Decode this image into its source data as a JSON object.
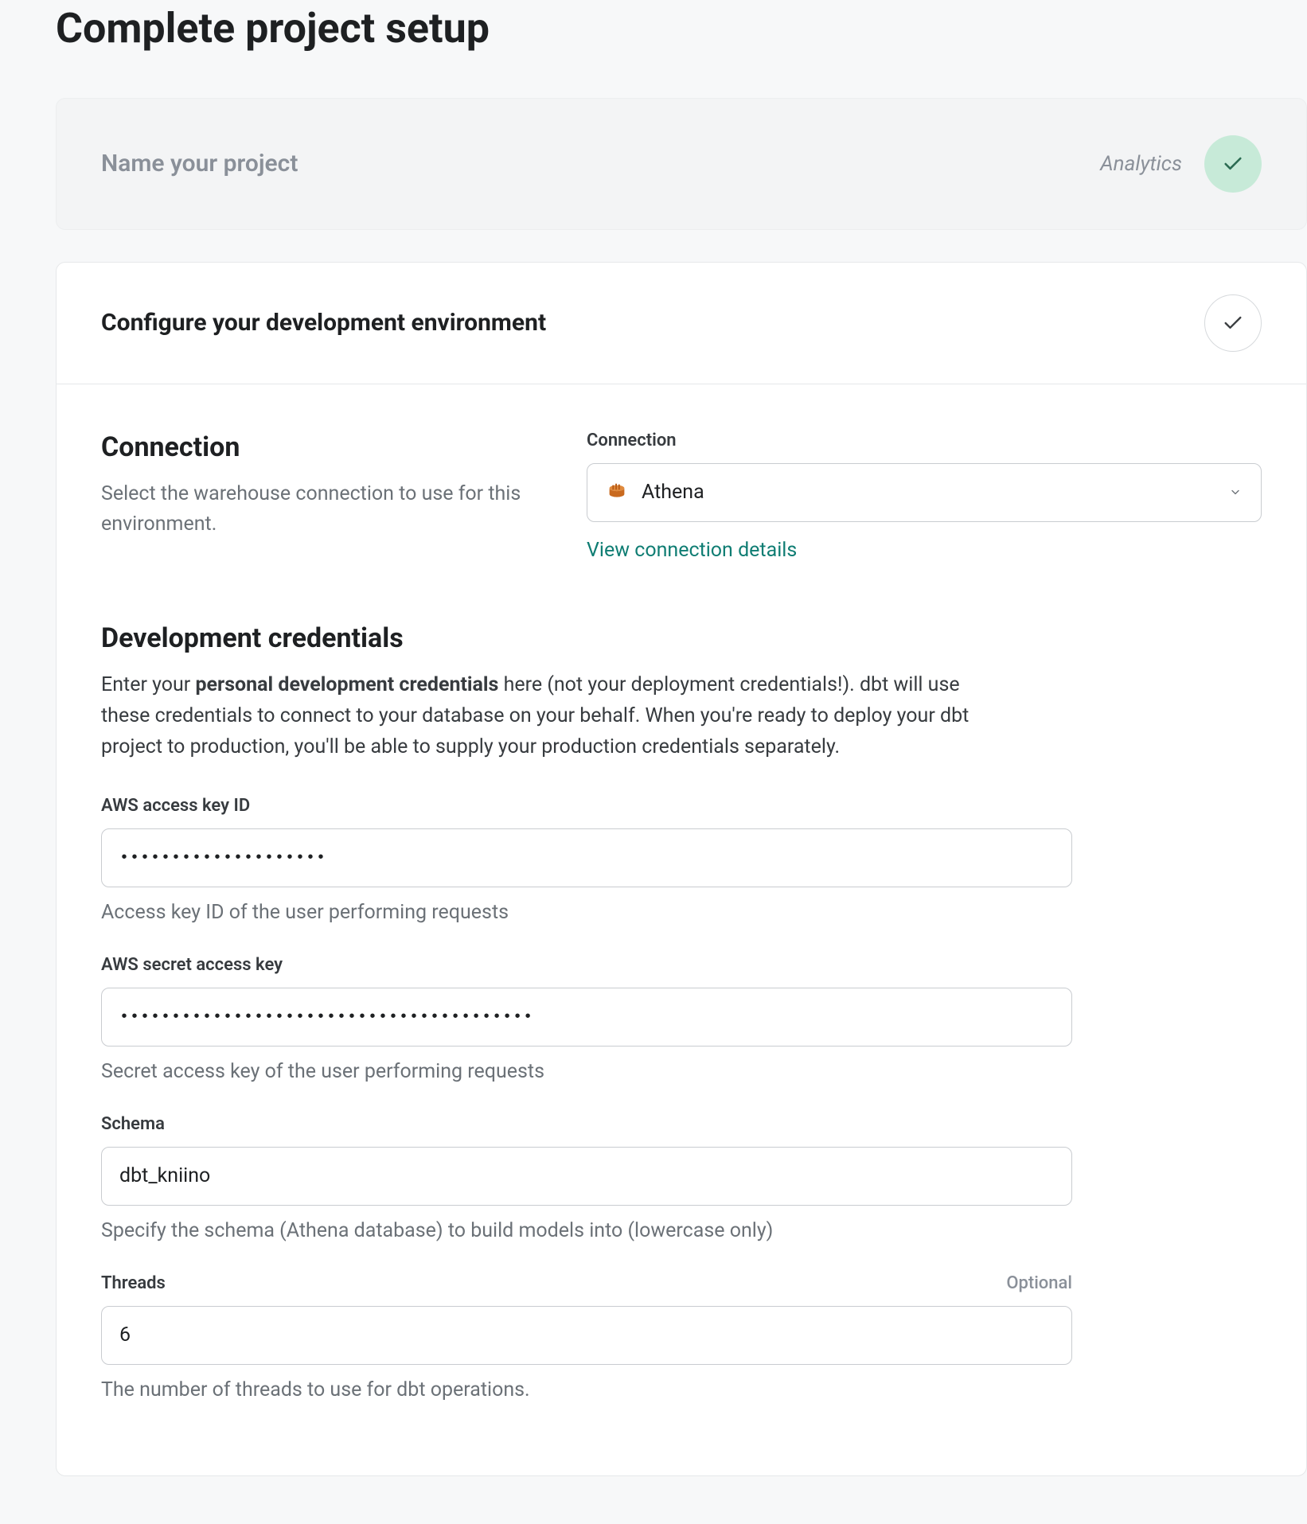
{
  "page_title": "Complete project setup",
  "step1": {
    "heading": "Name your project",
    "value": "Analytics"
  },
  "step2": {
    "heading": "Configure your development environment"
  },
  "connection_section": {
    "title": "Connection",
    "description": "Select the warehouse connection to use for this environment.",
    "field_label": "Connection",
    "selected": "Athena",
    "details_link": "View connection details"
  },
  "credentials_section": {
    "title": "Development credentials",
    "desc_prefix": "Enter your ",
    "desc_bold": "personal development credentials",
    "desc_suffix": " here (not your deployment credentials!). dbt will use these credentials to connect to your database on your behalf. When you're ready to deploy your dbt project to production, you'll be able to supply your production credentials separately.",
    "fields": {
      "access_key": {
        "label": "AWS access key ID",
        "value": "••••••••••••••••••••",
        "help": "Access key ID of the user performing requests"
      },
      "secret_key": {
        "label": "AWS secret access key",
        "value": "••••••••••••••••••••••••••••••••••••••••",
        "help": "Secret access key of the user performing requests"
      },
      "schema": {
        "label": "Schema",
        "value": "dbt_kniino",
        "help": "Specify the schema (Athena database) to build models into (lowercase only)"
      },
      "threads": {
        "label": "Threads",
        "optional": "Optional",
        "value": "6",
        "help": "The number of threads to use for dbt operations."
      }
    }
  }
}
